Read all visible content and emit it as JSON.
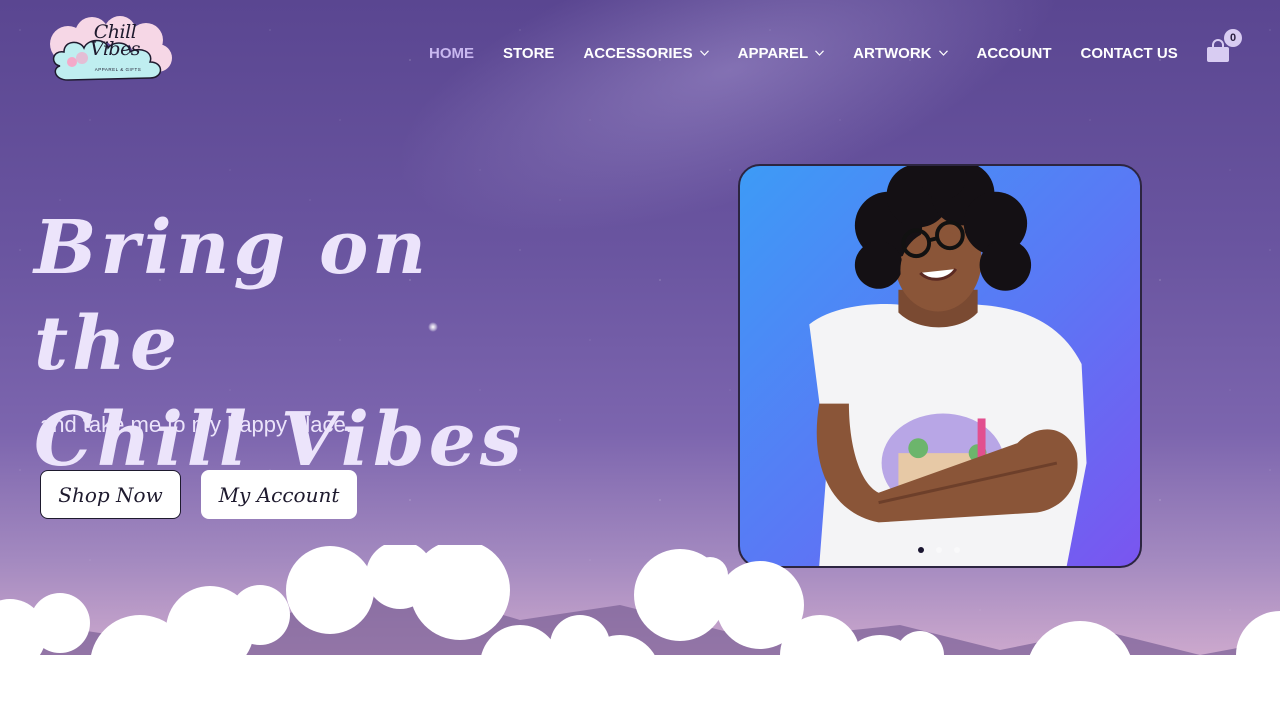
{
  "brand": {
    "logo_title": "Chill Vibes",
    "logo_subtitle": "APPAREL & GIFTS"
  },
  "nav": {
    "items": [
      {
        "label": "HOME",
        "active": true,
        "dropdown": false
      },
      {
        "label": "STORE",
        "active": false,
        "dropdown": false
      },
      {
        "label": "ACCESSORIES",
        "active": false,
        "dropdown": true
      },
      {
        "label": "APPAREL",
        "active": false,
        "dropdown": true
      },
      {
        "label": "ARTWORK",
        "active": false,
        "dropdown": true
      },
      {
        "label": "ACCOUNT",
        "active": false,
        "dropdown": false
      },
      {
        "label": "CONTACT US",
        "active": false,
        "dropdown": false
      }
    ]
  },
  "cart": {
    "icon": "shopping-bag-icon",
    "count": "0"
  },
  "hero": {
    "title_line1": "Bring on the",
    "title_line2": "Chill Vibes",
    "subtitle": "and take me to my happy place.",
    "primary_button": "Shop Now",
    "secondary_button": "My Account"
  },
  "slider": {
    "slide_count": 3,
    "active_slide": 1
  },
  "colors": {
    "accent_nav_active": "#c9b8f0",
    "hero_text": "#ece4fb",
    "card_gradient_start": "#3d9bf6",
    "card_gradient_end": "#7a55f0"
  }
}
